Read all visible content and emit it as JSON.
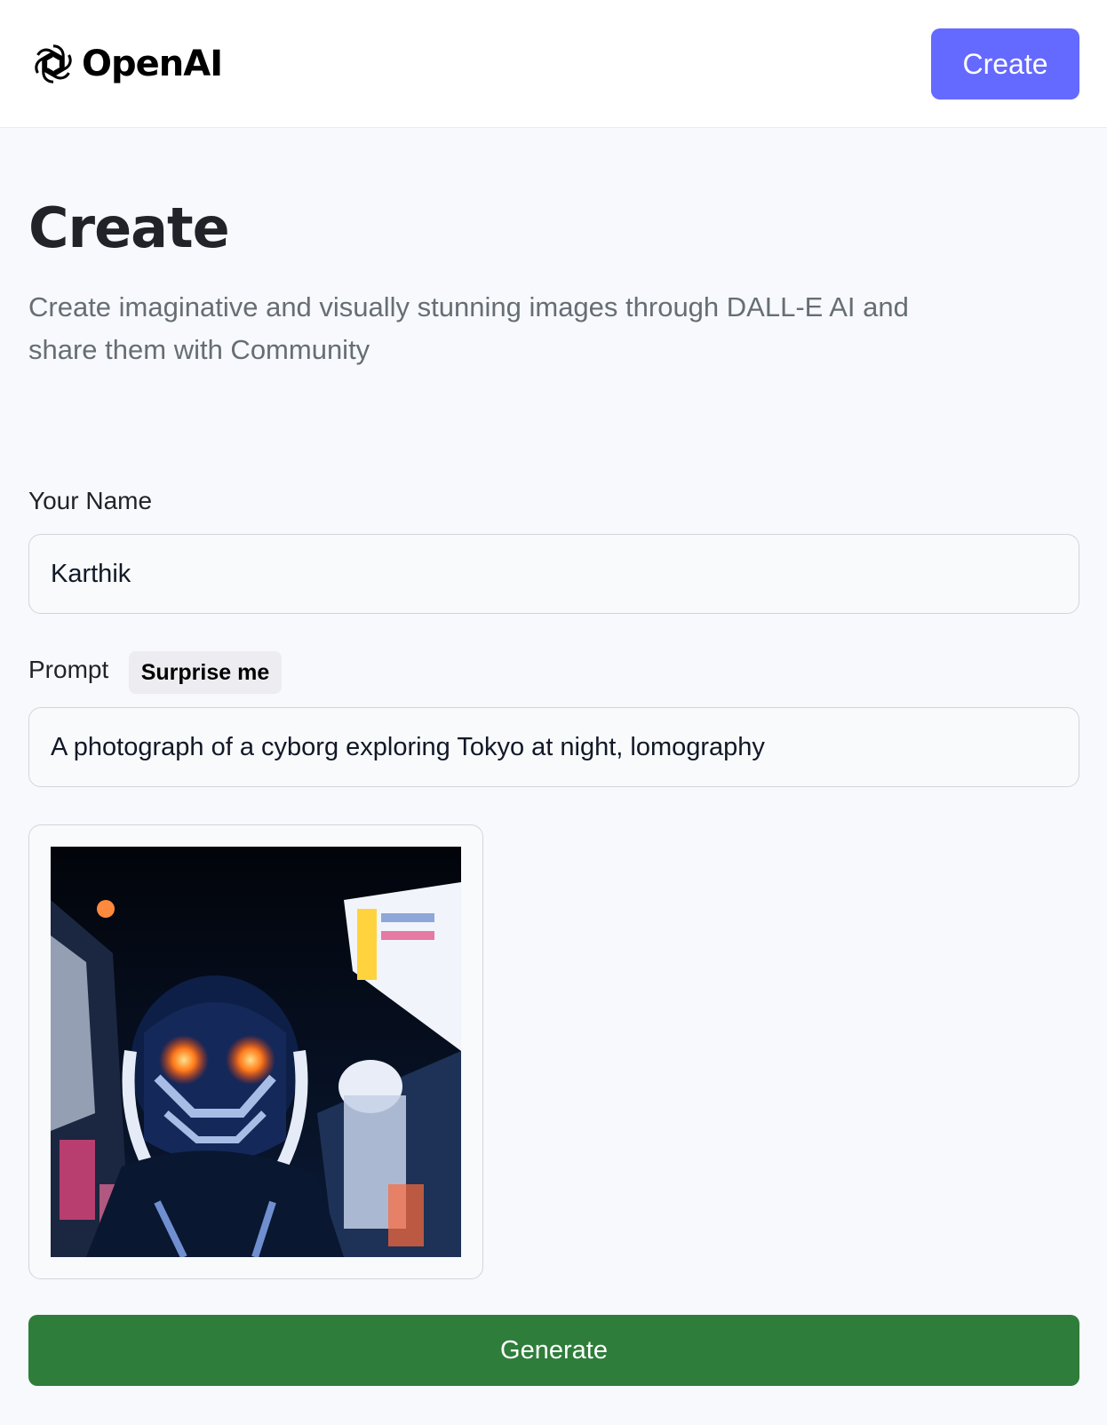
{
  "header": {
    "logo_text": "OpenAI",
    "logo_icon": "openai-logo-icon",
    "create_label": "Create"
  },
  "main": {
    "title": "Create",
    "subtitle": "Create imaginative and visually stunning images through DALL-E AI and share them with Community"
  },
  "form": {
    "name_label": "Your Name",
    "name_value": "Karthik",
    "prompt_label": "Prompt",
    "surprise_label": "Surprise me",
    "prompt_value": "A photograph of a cyborg exploring Tokyo at night, lomography",
    "generate_label": "Generate"
  },
  "colors": {
    "accent": "#6469ff",
    "generate": "#2e7d3a",
    "background": "#f8f9fc"
  }
}
